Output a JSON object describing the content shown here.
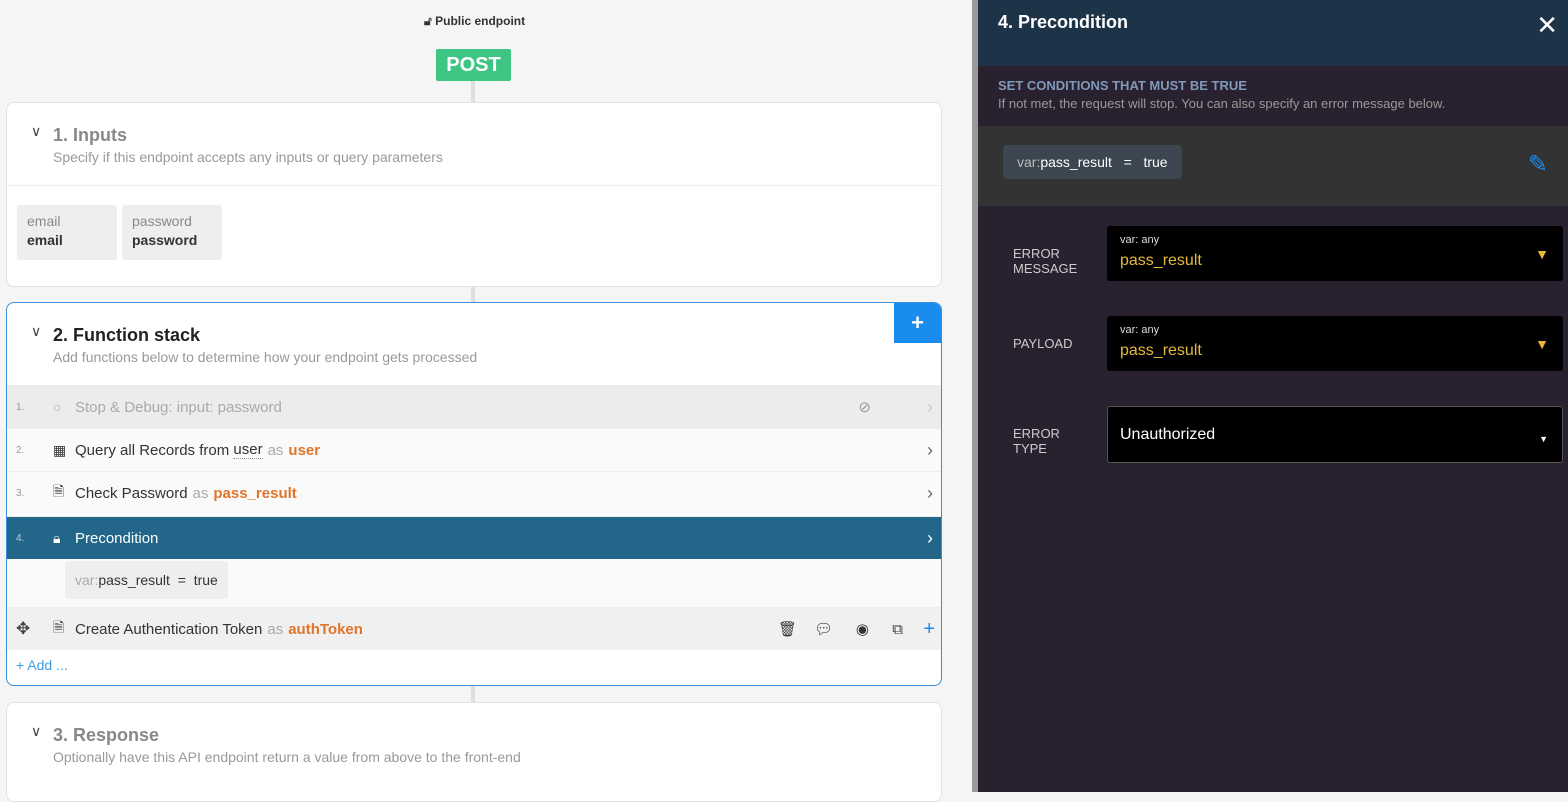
{
  "endpoint": {
    "access": "Public endpoint",
    "method": "POST"
  },
  "inputs": {
    "title": "1. Inputs",
    "subtitle": "Specify if this endpoint accepts any inputs or query parameters",
    "fields": [
      {
        "type": "email",
        "name": "email"
      },
      {
        "type": "password",
        "name": "password"
      }
    ]
  },
  "stack": {
    "title": "2. Function stack",
    "subtitle": "Add functions below to determine how your endpoint gets processed",
    "add_label": "+ Add ...",
    "as": "as",
    "items": [
      {
        "num": "1.",
        "label": "Stop & Debug: input: password"
      },
      {
        "num": "2.",
        "label": "Query all Records from",
        "table": "user",
        "var": "user"
      },
      {
        "num": "3.",
        "label": "Check Password",
        "var": "pass_result"
      },
      {
        "num": "4.",
        "label": "Precondition"
      },
      {
        "label": "Create Authentication Token",
        "var": "authToken"
      }
    ],
    "condition": {
      "prefix": "var:",
      "name": "pass_result",
      "op": "=",
      "value": "true"
    }
  },
  "response": {
    "title": "3. Response",
    "subtitle": "Optionally have this API endpoint return a value from above to the front-end"
  },
  "panel": {
    "title": "4. Precondition",
    "heading": "SET CONDITIONS THAT MUST BE TRUE",
    "desc": "If not met, the request will stop. You can also specify an error message below.",
    "condition": {
      "prefix": "var:",
      "name": "pass_result",
      "op": "=",
      "value": "true"
    },
    "error_message": {
      "label1": "ERROR",
      "label2": "MESSAGE",
      "type": "var: any",
      "value": "pass_result"
    },
    "payload": {
      "label": "PAYLOAD",
      "type": "var: any",
      "value": "pass_result"
    },
    "error_type": {
      "label1": "ERROR",
      "label2": "TYPE",
      "value": "Unauthorized"
    }
  }
}
